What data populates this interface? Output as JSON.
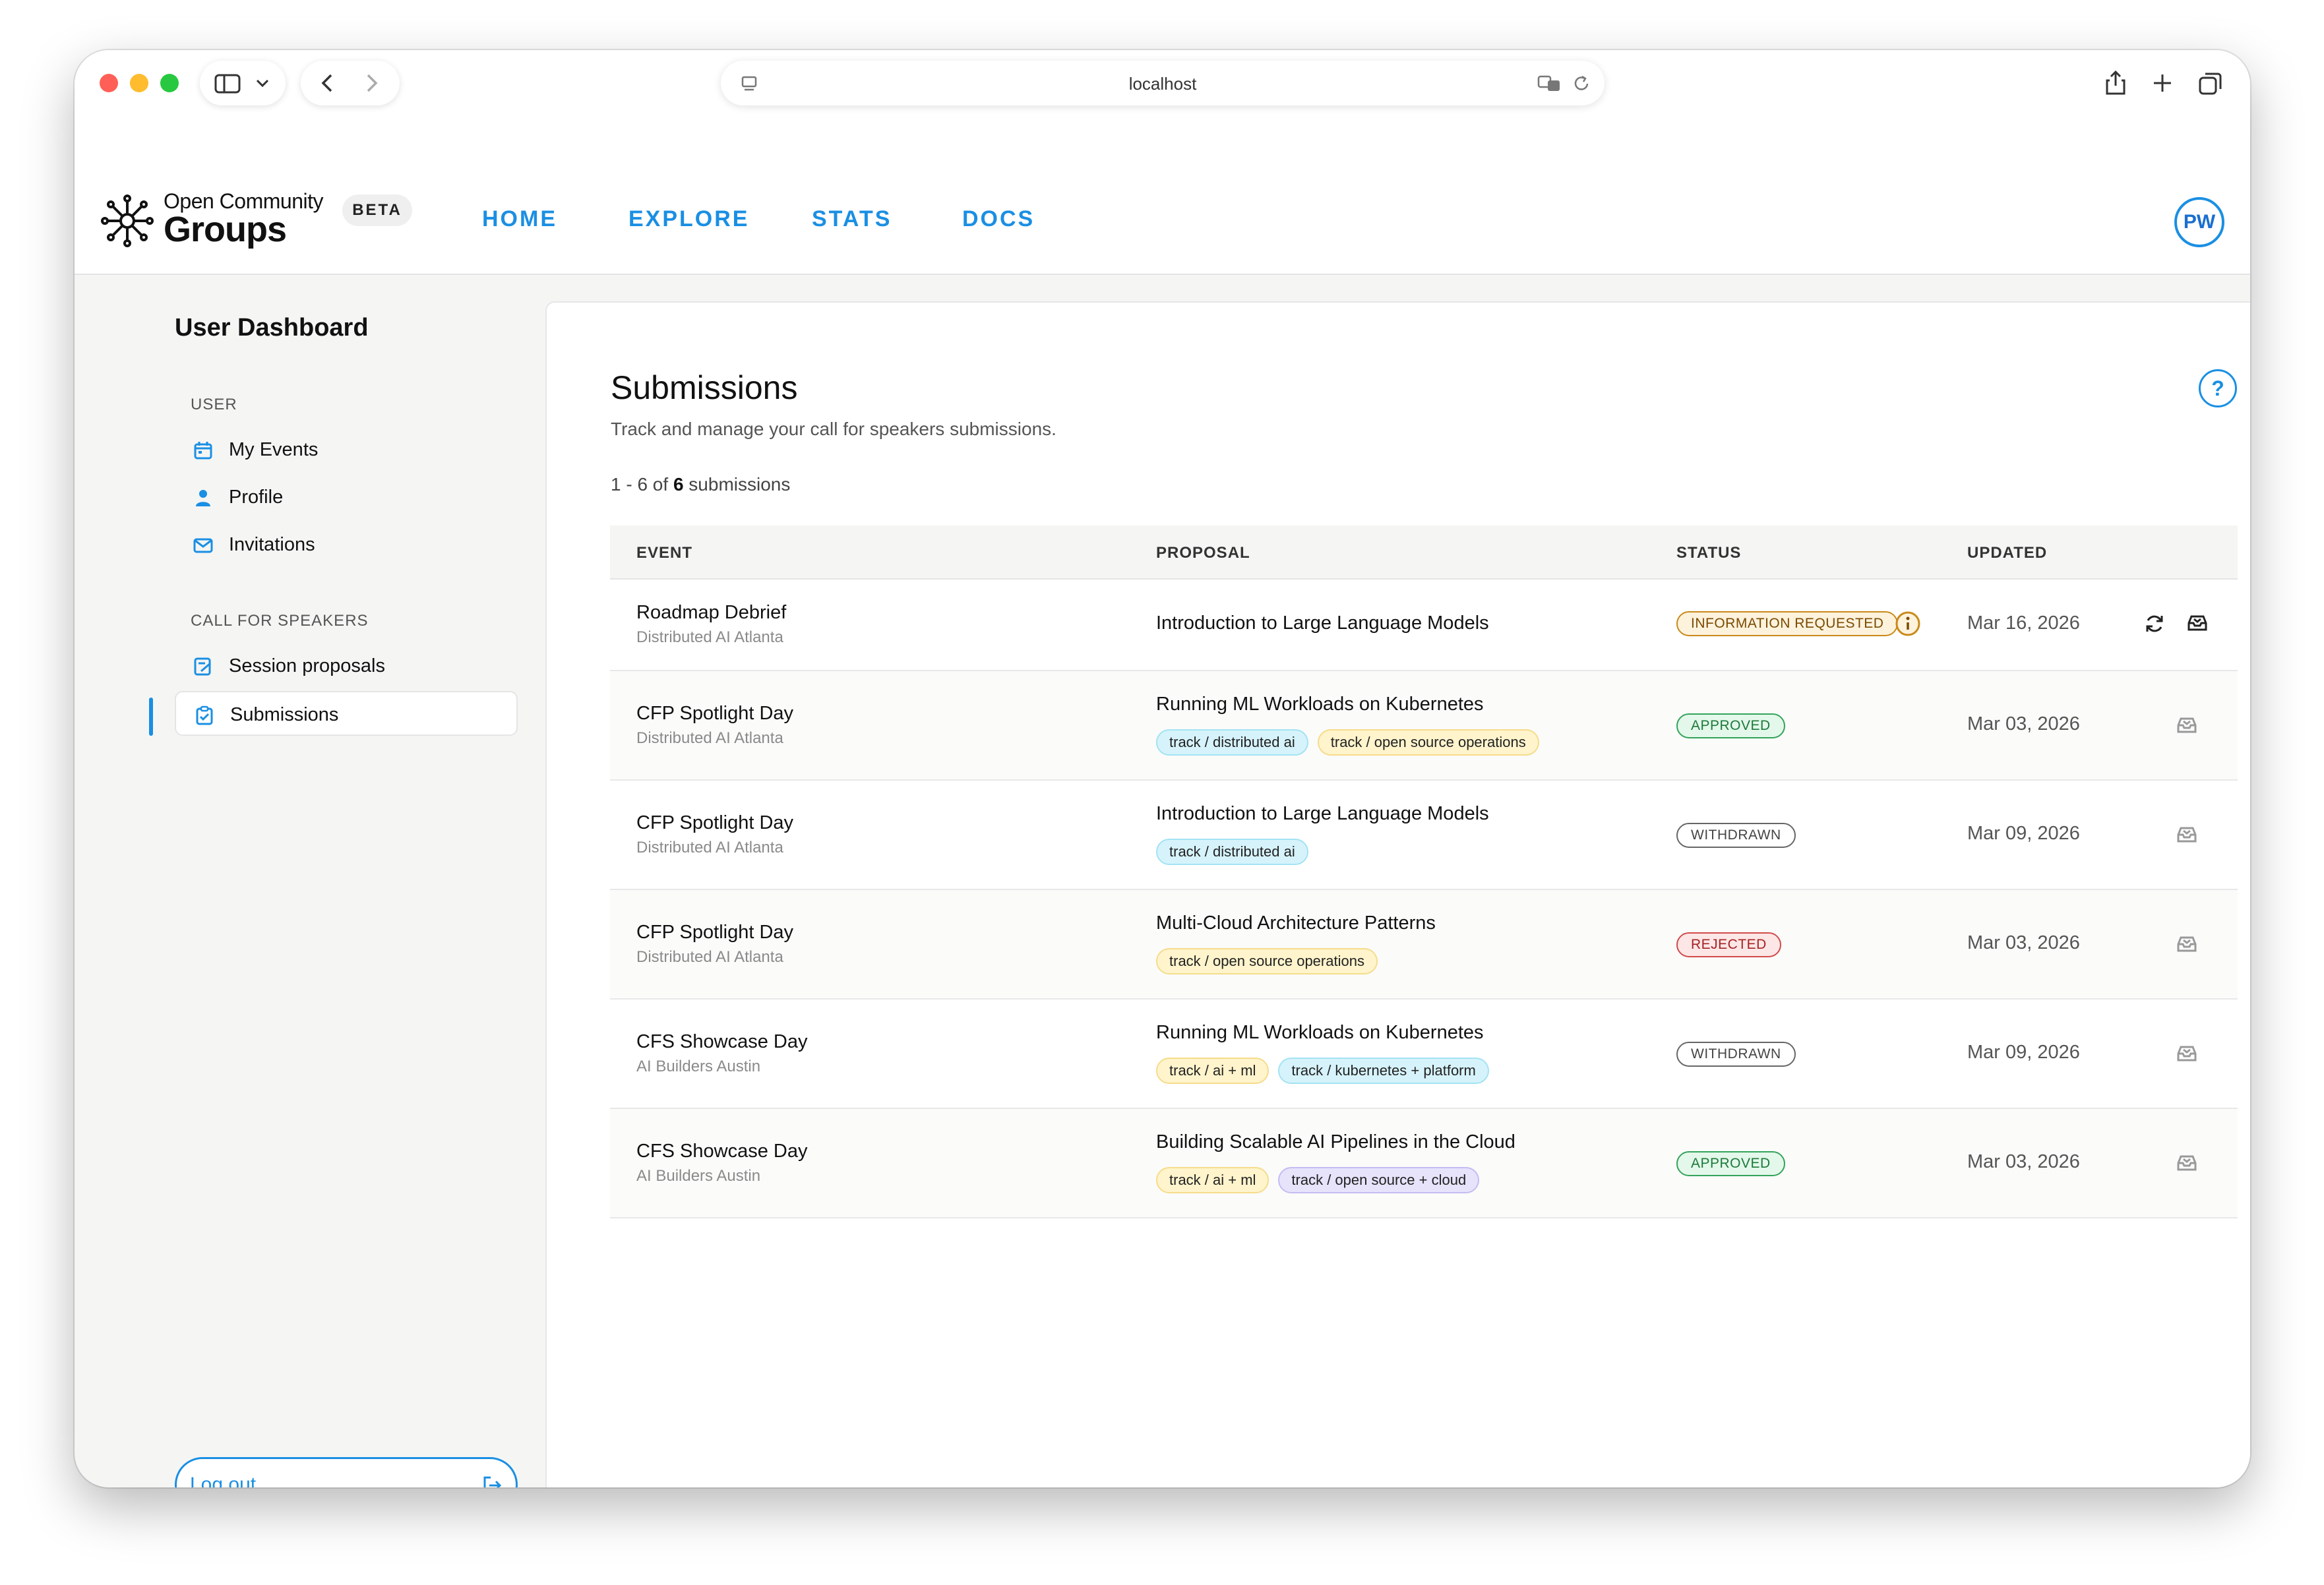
{
  "browser": {
    "url": "localhost"
  },
  "header": {
    "logo_top": "Open Community",
    "logo_main": "Groups",
    "badge": "BETA",
    "nav": [
      "HOME",
      "EXPLORE",
      "STATS",
      "DOCS"
    ],
    "avatar_initials": "PW"
  },
  "sidebar": {
    "title": "User Dashboard",
    "sections": [
      {
        "label": "USER",
        "items": [
          "My Events",
          "Profile",
          "Invitations"
        ]
      },
      {
        "label": "CALL FOR SPEAKERS",
        "items": [
          "Session proposals",
          "Submissions"
        ]
      }
    ],
    "active_item": "Submissions",
    "logout_label": "Log out"
  },
  "main": {
    "title": "Submissions",
    "subtitle": "Track and manage your call for speakers submissions.",
    "count_prefix": "1 - 6 of ",
    "count_total": "6",
    "count_suffix": " submissions",
    "columns": [
      "EVENT",
      "PROPOSAL",
      "STATUS",
      "UPDATED"
    ],
    "rows": [
      {
        "event": "Roadmap Debrief",
        "group": "Distributed AI Atlanta",
        "proposal": "Introduction to Large Language Models",
        "tags": [],
        "status": "INFORMATION REQUESTED",
        "updated": "Mar 16, 2026"
      },
      {
        "event": "CFP Spotlight Day",
        "group": "Distributed AI Atlanta",
        "proposal": "Running ML Workloads on Kubernetes",
        "tags": [
          "track / distributed ai",
          "track / open source operations"
        ],
        "status": "APPROVED",
        "updated": "Mar 03, 2026"
      },
      {
        "event": "CFP Spotlight Day",
        "group": "Distributed AI Atlanta",
        "proposal": "Introduction to Large Language Models",
        "tags": [
          "track / distributed ai"
        ],
        "status": "WITHDRAWN",
        "updated": "Mar 09, 2026"
      },
      {
        "event": "CFP Spotlight Day",
        "group": "Distributed AI Atlanta",
        "proposal": "Multi-Cloud Architecture Patterns",
        "tags": [
          "track / open source operations"
        ],
        "status": "REJECTED",
        "updated": "Mar 03, 2026"
      },
      {
        "event": "CFS Showcase Day",
        "group": "AI Builders Austin",
        "proposal": "Running ML Workloads on Kubernetes",
        "tags": [
          "track / ai + ml",
          "track / kubernetes + platform"
        ],
        "status": "WITHDRAWN",
        "updated": "Mar 09, 2026"
      },
      {
        "event": "CFS Showcase Day",
        "group": "AI Builders Austin",
        "proposal": "Building Scalable AI Pipelines in the Cloud",
        "tags": [
          "track / ai + ml",
          "track / open source + cloud"
        ],
        "status": "APPROVED",
        "updated": "Mar 03, 2026"
      }
    ]
  },
  "colors": {
    "accent": "#1a8fe3",
    "approved": "#33a35a",
    "rejected": "#d14b4b",
    "info_requested": "#c98a1a",
    "withdrawn": "#666666"
  },
  "icons": {
    "sidebar": [
      "calendar-icon",
      "person-icon",
      "envelope-icon",
      "edit-document-icon",
      "clipboard-check-icon"
    ],
    "row_actions": [
      "refresh-icon",
      "inbox-icon"
    ]
  }
}
